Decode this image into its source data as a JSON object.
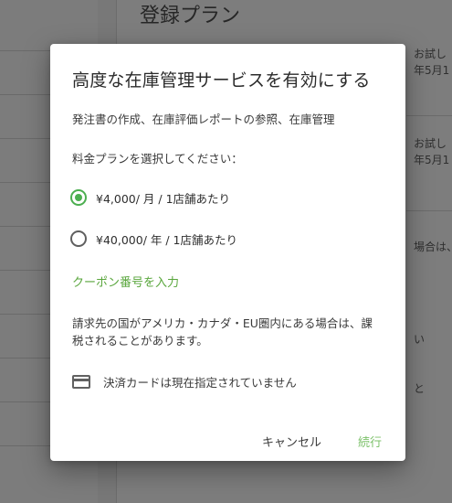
{
  "background": {
    "page_title": "登録プラン",
    "snippets": [
      {
        "line1": "お試し",
        "line2": "年5月1"
      },
      {
        "line1": "お試し",
        "line2": "年5月1"
      },
      {
        "line1": "場合は、",
        "line2": ""
      },
      {
        "line1": "い",
        "line2": ""
      },
      {
        "line1": "と",
        "line2": ""
      }
    ]
  },
  "dialog": {
    "title": "高度な在庫管理サービスを有効にする",
    "description": "発注書の作成、在庫評価レポートの参照、在庫管理",
    "prompt": "料金プランを選択してください：",
    "plans": [
      {
        "label": "¥4,000/ 月 / 1店舗あたり",
        "selected": true
      },
      {
        "label": "¥40,000/ 年 / 1店舗あたり",
        "selected": false
      }
    ],
    "coupon_link": "クーポン番号を入力",
    "tax_note": "請求先の国がアメリカ・カナダ・EU圏内にある場合は、課税されることがあります。",
    "card_status": "決済カードは現在指定されていません",
    "cancel_label": "キャンセル",
    "continue_label": "続行",
    "colors": {
      "accent": "#4caf50",
      "link": "#59a63c",
      "continue": "#7cc16a"
    },
    "icons": {
      "card": "credit-card-icon"
    }
  }
}
